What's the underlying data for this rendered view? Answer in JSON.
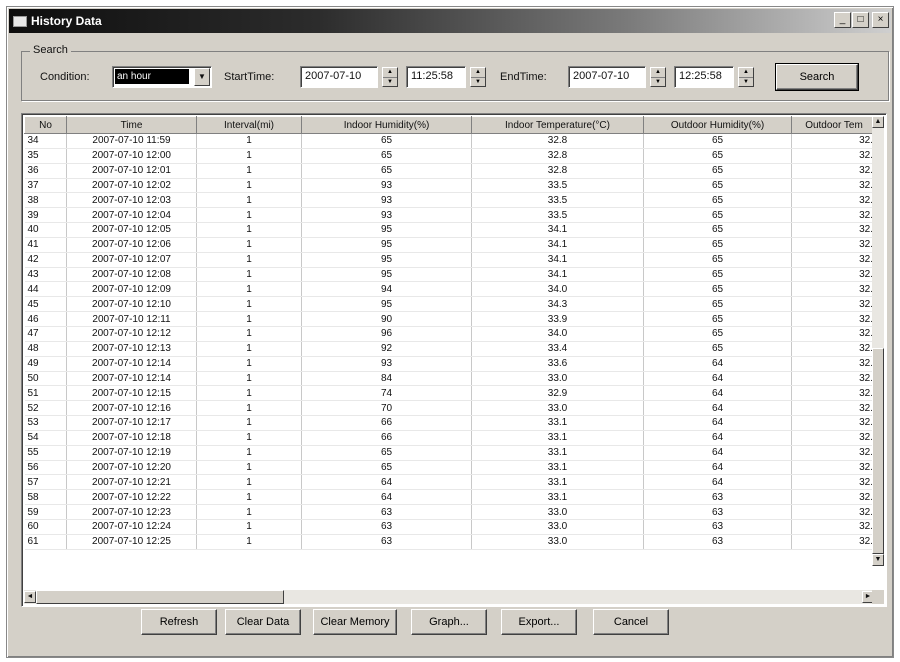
{
  "window": {
    "title": "History Data",
    "minimize": "_",
    "maximize": "□",
    "close": "×"
  },
  "search": {
    "group_label": "Search",
    "condition_label": "Condition:",
    "condition_value": "an hour",
    "start_label": "StartTime:",
    "start_date": "2007-07-10",
    "start_time": "11:25:58",
    "end_label": "EndTime:",
    "end_date": "2007-07-10",
    "end_time": "12:25:58",
    "search_button": "Search"
  },
  "table": {
    "columns": [
      "No",
      "Time",
      "Interval(mi)",
      "Indoor Humidity(%)",
      "Indoor Temperature(°C)",
      "Outdoor Humidity(%)",
      "Outdoor Tem"
    ],
    "rows": [
      [
        "34",
        "2007-07-10 11:59",
        "1",
        "65",
        "32.8",
        "65",
        "32."
      ],
      [
        "35",
        "2007-07-10 12:00",
        "1",
        "65",
        "32.8",
        "65",
        "32."
      ],
      [
        "36",
        "2007-07-10 12:01",
        "1",
        "65",
        "32.8",
        "65",
        "32."
      ],
      [
        "37",
        "2007-07-10 12:02",
        "1",
        "93",
        "33.5",
        "65",
        "32."
      ],
      [
        "38",
        "2007-07-10 12:03",
        "1",
        "93",
        "33.5",
        "65",
        "32."
      ],
      [
        "39",
        "2007-07-10 12:04",
        "1",
        "93",
        "33.5",
        "65",
        "32."
      ],
      [
        "40",
        "2007-07-10 12:05",
        "1",
        "95",
        "34.1",
        "65",
        "32."
      ],
      [
        "41",
        "2007-07-10 12:06",
        "1",
        "95",
        "34.1",
        "65",
        "32."
      ],
      [
        "42",
        "2007-07-10 12:07",
        "1",
        "95",
        "34.1",
        "65",
        "32."
      ],
      [
        "43",
        "2007-07-10 12:08",
        "1",
        "95",
        "34.1",
        "65",
        "32."
      ],
      [
        "44",
        "2007-07-10 12:09",
        "1",
        "94",
        "34.0",
        "65",
        "32."
      ],
      [
        "45",
        "2007-07-10 12:10",
        "1",
        "95",
        "34.3",
        "65",
        "32."
      ],
      [
        "46",
        "2007-07-10 12:11",
        "1",
        "90",
        "33.9",
        "65",
        "32."
      ],
      [
        "47",
        "2007-07-10 12:12",
        "1",
        "96",
        "34.0",
        "65",
        "32."
      ],
      [
        "48",
        "2007-07-10 12:13",
        "1",
        "92",
        "33.4",
        "65",
        "32."
      ],
      [
        "49",
        "2007-07-10 12:14",
        "1",
        "93",
        "33.6",
        "64",
        "32."
      ],
      [
        "50",
        "2007-07-10 12:14",
        "1",
        "84",
        "33.0",
        "64",
        "32."
      ],
      [
        "51",
        "2007-07-10 12:15",
        "1",
        "74",
        "32.9",
        "64",
        "32."
      ],
      [
        "52",
        "2007-07-10 12:16",
        "1",
        "70",
        "33.0",
        "64",
        "32."
      ],
      [
        "53",
        "2007-07-10 12:17",
        "1",
        "66",
        "33.1",
        "64",
        "32."
      ],
      [
        "54",
        "2007-07-10 12:18",
        "1",
        "66",
        "33.1",
        "64",
        "32."
      ],
      [
        "55",
        "2007-07-10 12:19",
        "1",
        "65",
        "33.1",
        "64",
        "32."
      ],
      [
        "56",
        "2007-07-10 12:20",
        "1",
        "65",
        "33.1",
        "64",
        "32."
      ],
      [
        "57",
        "2007-07-10 12:21",
        "1",
        "64",
        "33.1",
        "64",
        "32."
      ],
      [
        "58",
        "2007-07-10 12:22",
        "1",
        "64",
        "33.1",
        "63",
        "32."
      ],
      [
        "59",
        "2007-07-10 12:23",
        "1",
        "63",
        "33.0",
        "63",
        "32."
      ],
      [
        "60",
        "2007-07-10 12:24",
        "1",
        "63",
        "33.0",
        "63",
        "32."
      ],
      [
        "61",
        "2007-07-10 12:25",
        "1",
        "63",
        "33.0",
        "63",
        "32."
      ]
    ]
  },
  "buttons": {
    "refresh": "Refresh",
    "clear_data": "Clear Data",
    "clear_memory": "Clear Memory",
    "graph": "Graph...",
    "export": "Export...",
    "cancel": "Cancel"
  },
  "icons": {
    "spin_up": "▲",
    "spin_down": "▼",
    "dropdown": "▼",
    "scroll_up": "▲",
    "scroll_down": "▼",
    "scroll_left": "◄",
    "scroll_right": "►"
  }
}
